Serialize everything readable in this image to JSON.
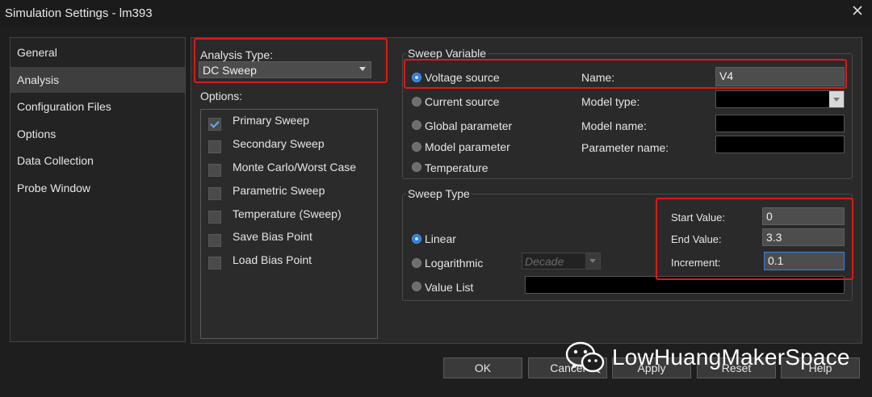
{
  "window": {
    "title": "Simulation Settings - lm393"
  },
  "nav": {
    "items": [
      "General",
      "Analysis",
      "Configuration Files",
      "Options",
      "Data Collection",
      "Probe Window"
    ],
    "selected": "Analysis"
  },
  "analysis": {
    "type_label": "Analysis Type:",
    "type_value": "DC Sweep",
    "options_label": "Options:",
    "options": [
      {
        "label": "Primary Sweep",
        "checked": true
      },
      {
        "label": "Secondary Sweep",
        "checked": false
      },
      {
        "label": "Monte Carlo/Worst Case",
        "checked": false
      },
      {
        "label": "Parametric Sweep",
        "checked": false
      },
      {
        "label": "Temperature (Sweep)",
        "checked": false
      },
      {
        "label": "Save Bias Point",
        "checked": false
      },
      {
        "label": "Load Bias Point",
        "checked": false
      }
    ]
  },
  "sweep_variable": {
    "title": "Sweep Variable",
    "options": [
      "Voltage source",
      "Current source",
      "Global parameter",
      "Model parameter",
      "Temperature"
    ],
    "selected": "Voltage source",
    "name_label": "Name:",
    "name_value": "V4",
    "model_type_label": "Model type:",
    "model_type_value": "",
    "model_name_label": "Model name:",
    "model_name_value": "",
    "parameter_name_label": "Parameter name:",
    "parameter_name_value": ""
  },
  "sweep_type": {
    "title": "Sweep Type",
    "options": [
      "Linear",
      "Logarithmic",
      "Value List"
    ],
    "selected": "Linear",
    "log_select_value": "Decade",
    "value_list_value": "",
    "start_label": "Start Value:",
    "start_value": "0",
    "end_label": "End Value:",
    "end_value": "3.3",
    "increment_label": "Increment:",
    "increment_value": "0.1"
  },
  "buttons": {
    "ok": "OK",
    "cancel": "Cancel",
    "apply": "Apply",
    "reset": "Reset",
    "help": "Help"
  },
  "watermark": {
    "text": "LowHuangMakerSpace"
  },
  "colors": {
    "highlight": "#e01818",
    "accent": "#2f7ddc"
  }
}
